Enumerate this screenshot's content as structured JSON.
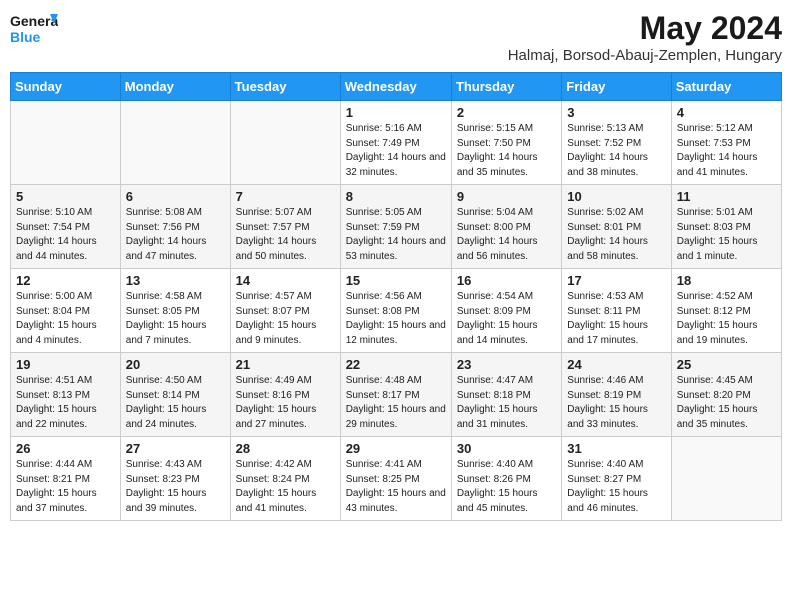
{
  "logo": {
    "line1": "General",
    "line2": "Blue"
  },
  "title": "May 2024",
  "subtitle": "Halmaj, Borsod-Abauj-Zemplen, Hungary",
  "days_of_week": [
    "Sunday",
    "Monday",
    "Tuesday",
    "Wednesday",
    "Thursday",
    "Friday",
    "Saturday"
  ],
  "weeks": [
    [
      {
        "day": "",
        "info": ""
      },
      {
        "day": "",
        "info": ""
      },
      {
        "day": "",
        "info": ""
      },
      {
        "day": "1",
        "info": "Sunrise: 5:16 AM\nSunset: 7:49 PM\nDaylight: 14 hours and 32 minutes."
      },
      {
        "day": "2",
        "info": "Sunrise: 5:15 AM\nSunset: 7:50 PM\nDaylight: 14 hours and 35 minutes."
      },
      {
        "day": "3",
        "info": "Sunrise: 5:13 AM\nSunset: 7:52 PM\nDaylight: 14 hours and 38 minutes."
      },
      {
        "day": "4",
        "info": "Sunrise: 5:12 AM\nSunset: 7:53 PM\nDaylight: 14 hours and 41 minutes."
      }
    ],
    [
      {
        "day": "5",
        "info": "Sunrise: 5:10 AM\nSunset: 7:54 PM\nDaylight: 14 hours and 44 minutes."
      },
      {
        "day": "6",
        "info": "Sunrise: 5:08 AM\nSunset: 7:56 PM\nDaylight: 14 hours and 47 minutes."
      },
      {
        "day": "7",
        "info": "Sunrise: 5:07 AM\nSunset: 7:57 PM\nDaylight: 14 hours and 50 minutes."
      },
      {
        "day": "8",
        "info": "Sunrise: 5:05 AM\nSunset: 7:59 PM\nDaylight: 14 hours and 53 minutes."
      },
      {
        "day": "9",
        "info": "Sunrise: 5:04 AM\nSunset: 8:00 PM\nDaylight: 14 hours and 56 minutes."
      },
      {
        "day": "10",
        "info": "Sunrise: 5:02 AM\nSunset: 8:01 PM\nDaylight: 14 hours and 58 minutes."
      },
      {
        "day": "11",
        "info": "Sunrise: 5:01 AM\nSunset: 8:03 PM\nDaylight: 15 hours and 1 minute."
      }
    ],
    [
      {
        "day": "12",
        "info": "Sunrise: 5:00 AM\nSunset: 8:04 PM\nDaylight: 15 hours and 4 minutes."
      },
      {
        "day": "13",
        "info": "Sunrise: 4:58 AM\nSunset: 8:05 PM\nDaylight: 15 hours and 7 minutes."
      },
      {
        "day": "14",
        "info": "Sunrise: 4:57 AM\nSunset: 8:07 PM\nDaylight: 15 hours and 9 minutes."
      },
      {
        "day": "15",
        "info": "Sunrise: 4:56 AM\nSunset: 8:08 PM\nDaylight: 15 hours and 12 minutes."
      },
      {
        "day": "16",
        "info": "Sunrise: 4:54 AM\nSunset: 8:09 PM\nDaylight: 15 hours and 14 minutes."
      },
      {
        "day": "17",
        "info": "Sunrise: 4:53 AM\nSunset: 8:11 PM\nDaylight: 15 hours and 17 minutes."
      },
      {
        "day": "18",
        "info": "Sunrise: 4:52 AM\nSunset: 8:12 PM\nDaylight: 15 hours and 19 minutes."
      }
    ],
    [
      {
        "day": "19",
        "info": "Sunrise: 4:51 AM\nSunset: 8:13 PM\nDaylight: 15 hours and 22 minutes."
      },
      {
        "day": "20",
        "info": "Sunrise: 4:50 AM\nSunset: 8:14 PM\nDaylight: 15 hours and 24 minutes."
      },
      {
        "day": "21",
        "info": "Sunrise: 4:49 AM\nSunset: 8:16 PM\nDaylight: 15 hours and 27 minutes."
      },
      {
        "day": "22",
        "info": "Sunrise: 4:48 AM\nSunset: 8:17 PM\nDaylight: 15 hours and 29 minutes."
      },
      {
        "day": "23",
        "info": "Sunrise: 4:47 AM\nSunset: 8:18 PM\nDaylight: 15 hours and 31 minutes."
      },
      {
        "day": "24",
        "info": "Sunrise: 4:46 AM\nSunset: 8:19 PM\nDaylight: 15 hours and 33 minutes."
      },
      {
        "day": "25",
        "info": "Sunrise: 4:45 AM\nSunset: 8:20 PM\nDaylight: 15 hours and 35 minutes."
      }
    ],
    [
      {
        "day": "26",
        "info": "Sunrise: 4:44 AM\nSunset: 8:21 PM\nDaylight: 15 hours and 37 minutes."
      },
      {
        "day": "27",
        "info": "Sunrise: 4:43 AM\nSunset: 8:23 PM\nDaylight: 15 hours and 39 minutes."
      },
      {
        "day": "28",
        "info": "Sunrise: 4:42 AM\nSunset: 8:24 PM\nDaylight: 15 hours and 41 minutes."
      },
      {
        "day": "29",
        "info": "Sunrise: 4:41 AM\nSunset: 8:25 PM\nDaylight: 15 hours and 43 minutes."
      },
      {
        "day": "30",
        "info": "Sunrise: 4:40 AM\nSunset: 8:26 PM\nDaylight: 15 hours and 45 minutes."
      },
      {
        "day": "31",
        "info": "Sunrise: 4:40 AM\nSunset: 8:27 PM\nDaylight: 15 hours and 46 minutes."
      },
      {
        "day": "",
        "info": ""
      }
    ]
  ]
}
